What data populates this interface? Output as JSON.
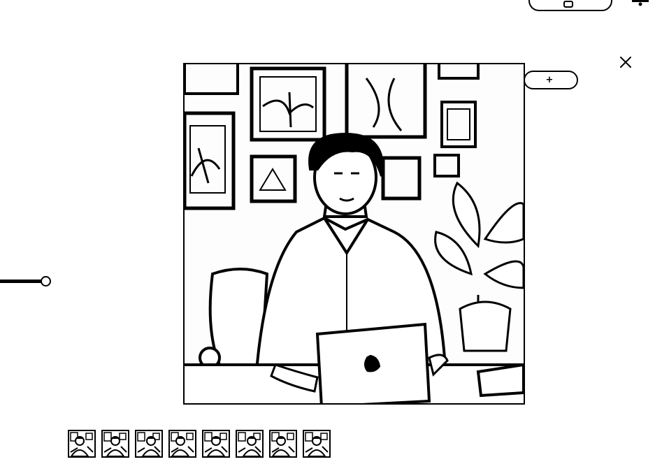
{
  "top_bar": {
    "pill_label": "",
    "bell_icon": "bell-icon"
  },
  "viewer": {
    "close_icon": "close-icon",
    "action_button": {
      "plus": "+",
      "label": ""
    }
  },
  "slider": {
    "value": 0.8
  },
  "thumbnails": {
    "count": 8,
    "items": [
      "thumb-1",
      "thumb-2",
      "thumb-3",
      "thumb-4",
      "thumb-5",
      "thumb-6",
      "thumb-7",
      "thumb-8"
    ]
  },
  "colors": {
    "ink": "#000000",
    "paper": "#ffffff"
  }
}
